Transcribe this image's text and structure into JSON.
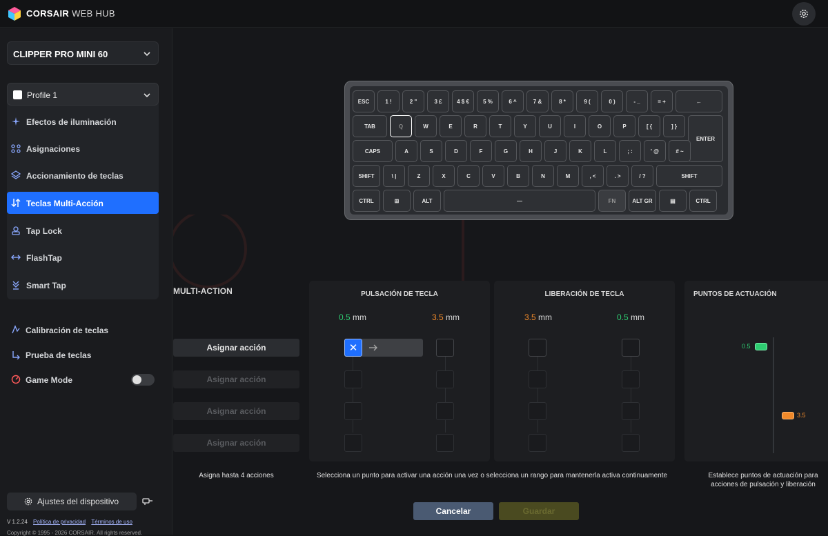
{
  "app": {
    "brand": "CORSAIR",
    "brand_sub": "WEB HUB"
  },
  "sidebar": {
    "device": "CLIPPER PRO MINI 60",
    "profile": "Profile 1",
    "items": [
      {
        "label": "Efectos de iluminación",
        "icon": "sparkle-icon"
      },
      {
        "label": "Asignaciones",
        "icon": "assignments-icon"
      },
      {
        "label": "Accionamiento de teclas",
        "icon": "layers-icon"
      },
      {
        "label": "Teclas Multi-Acción",
        "icon": "multi-action-icon",
        "active": true
      },
      {
        "label": "Tap Lock",
        "icon": "tap-lock-icon"
      },
      {
        "label": "FlashTap",
        "icon": "flashtap-icon"
      },
      {
        "label": "Smart Tap",
        "icon": "smart-tap-icon"
      }
    ],
    "tools": [
      {
        "label": "Calibración de teclas",
        "icon": "calibration-icon"
      },
      {
        "label": "Prueba de teclas",
        "icon": "key-test-icon"
      },
      {
        "label": "Game Mode",
        "icon": "game-mode-icon",
        "toggle": false
      }
    ],
    "device_settings": "Ajustes del dispositivo",
    "version": "V 1.2.24",
    "privacy": "Política de privacidad",
    "terms": "Términos de uso",
    "copyright": "Copyright © 1995 - 2026 CORSAIR. All rights reserved."
  },
  "keyboard": {
    "rows": [
      [
        "ESC",
        "1 !",
        "2 \"",
        "3 £",
        "4 $ €",
        "5 %",
        "6 ^",
        "7 &",
        "8 *",
        "9 (",
        "0 )",
        "- _",
        "= +",
        "←"
      ],
      [
        "TAB",
        "Q",
        "W",
        "E",
        "R",
        "T",
        "Y",
        "U",
        "I",
        "O",
        "P",
        "[ {",
        "] }",
        "ENTER"
      ],
      [
        "CAPS",
        "A",
        "S",
        "D",
        "F",
        "G",
        "H",
        "J",
        "K",
        "L",
        "; :",
        "' @",
        "# ~"
      ],
      [
        "SHIFT",
        "\\ |",
        "Z",
        "X",
        "C",
        "V",
        "B",
        "N",
        "M",
        ", <",
        ". >",
        "/ ?",
        "SHIFT"
      ],
      [
        "CTRL",
        "⊞",
        "ALT",
        "—",
        "FN",
        "ALT GR",
        "▤",
        "CTRL"
      ]
    ],
    "selected_key": "Q",
    "fn_key": "FN"
  },
  "main": {
    "section_title": "MULTI-ACTION",
    "assign_label": "Asignar acción",
    "assign_note": "Asigna hasta 4 acciones",
    "press": {
      "title": "PULSACIÓN DE TECLA",
      "from": "0.5",
      "to": "3.5",
      "unit": "mm"
    },
    "release": {
      "title": "LIBERACIÓN DE TECLA",
      "from": "3.5",
      "to": "0.5",
      "unit": "mm"
    },
    "actuation": {
      "title": "PUNTOS DE ACTUACIÓN",
      "low": "0.5",
      "high": "3.5",
      "note": "Establece puntos de actuación para acciones de pulsación y liberación"
    },
    "range_note": "Selecciona un punto para activar una acción una vez o selecciona un rango para mantenerla activa continuamente",
    "cancel": "Cancelar",
    "save": "Guardar"
  },
  "colors": {
    "accent": "#1f6fff",
    "green": "#2ecc71",
    "orange": "#f0892a"
  }
}
